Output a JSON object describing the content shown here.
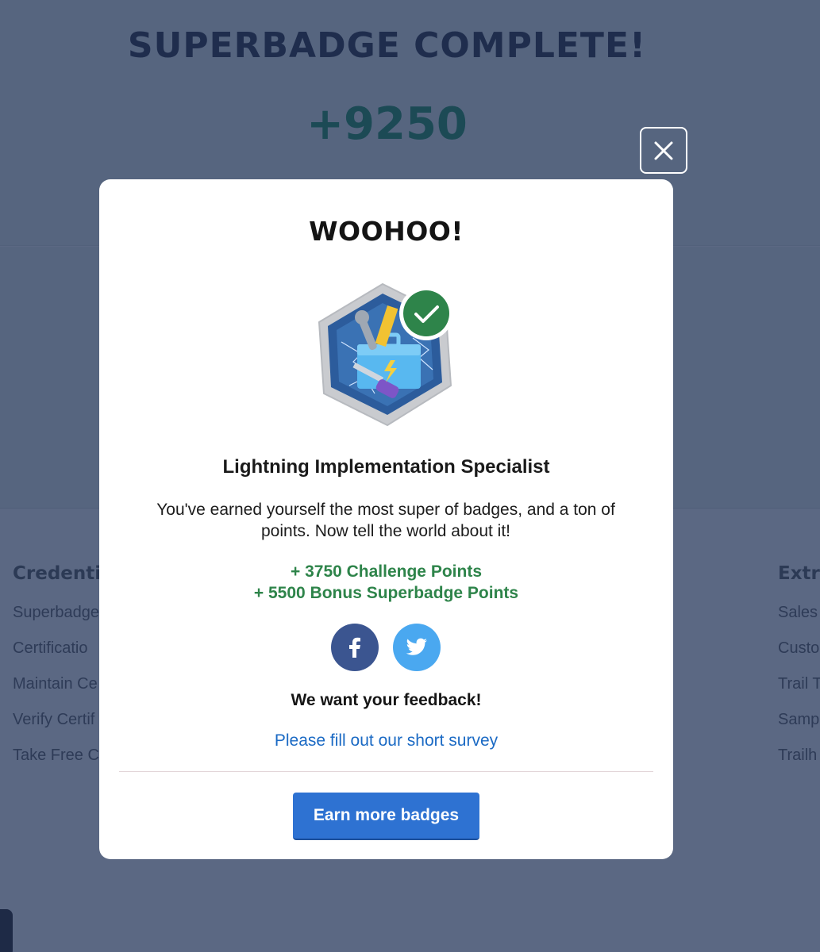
{
  "background": {
    "title": "SUPERBADGE COMPLETE!",
    "points": "+9250",
    "footer_left": {
      "heading": "Credentia",
      "links": [
        "Superbadge",
        "Certificatio",
        "Maintain Ce",
        "Verify Certif",
        "Take Free C"
      ]
    },
    "footer_right": {
      "heading": "Extra",
      "links": [
        "Sales",
        "Custo",
        "Trail T",
        "Samp",
        "Trailh"
      ]
    }
  },
  "modal": {
    "heading": "WOOHOO!",
    "badge_name": "Lightning Implementation Specialist",
    "message": "You've earned yourself the most super of badges, and a ton of points. Now tell the world about it!",
    "points": [
      "+ 3750 Challenge Points",
      "+ 5500 Bonus Superbadge Points"
    ],
    "feedback_heading": "We want your feedback!",
    "survey_link": "Please fill out our short survey",
    "cta_button": "Earn more badges"
  },
  "icons": {
    "close": "close-icon",
    "facebook": "facebook-icon",
    "twitter": "twitter-icon",
    "badge_check": "checkmark-icon"
  },
  "colors": {
    "points_green": "#2e844a",
    "link_blue": "#1b6ac4",
    "button_blue": "#2e72d2",
    "facebook": "#3b5590",
    "twitter": "#4aa8f0",
    "check_green": "#2e844a"
  }
}
